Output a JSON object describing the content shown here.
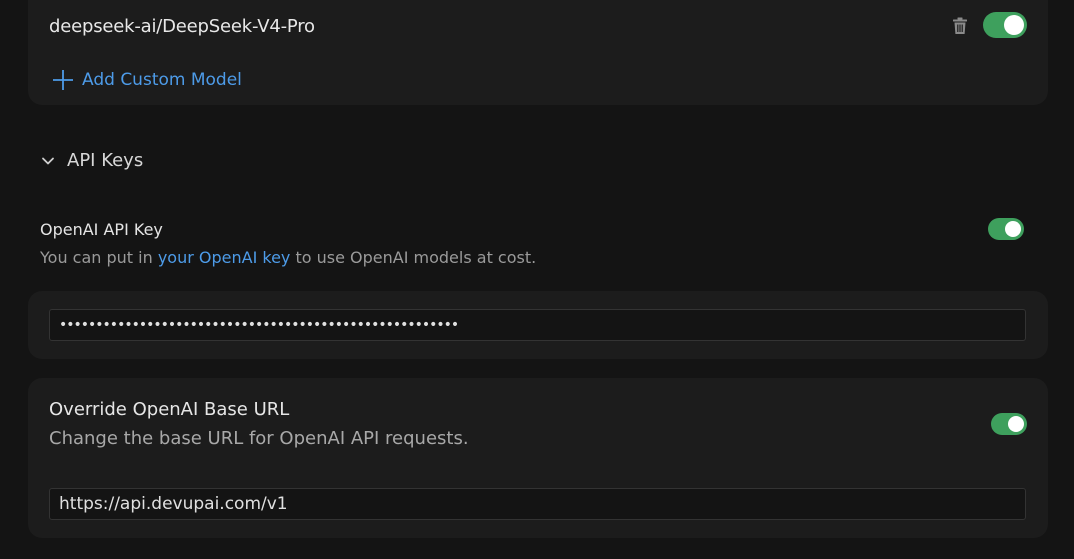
{
  "models": {
    "items": [
      {
        "name": "deepseek-ai/DeepSeek-V4-Pro",
        "enabled": true
      }
    ],
    "add_label": "Add Custom Model"
  },
  "api_keys": {
    "section_title": "API Keys",
    "openai_key": {
      "title": "OpenAI API Key",
      "desc_prefix": "You can put in ",
      "desc_link": "your OpenAI key",
      "desc_suffix": " to use OpenAI models at cost.",
      "enabled": true,
      "value": "•••••••••••••••••••••••••••••••••••••••••••••••••••••••"
    },
    "base_url": {
      "title": "Override OpenAI Base URL",
      "desc": "Change the base URL for OpenAI API requests.",
      "enabled": true,
      "value": "https://api.devupai.com/v1"
    }
  },
  "colors": {
    "accent": "#4d9be8",
    "toggle_on": "#3ea05d",
    "background": "#141414",
    "card": "#1c1c1c"
  },
  "icons": [
    "trash-icon",
    "plus-icon",
    "chevron-down-icon"
  ]
}
